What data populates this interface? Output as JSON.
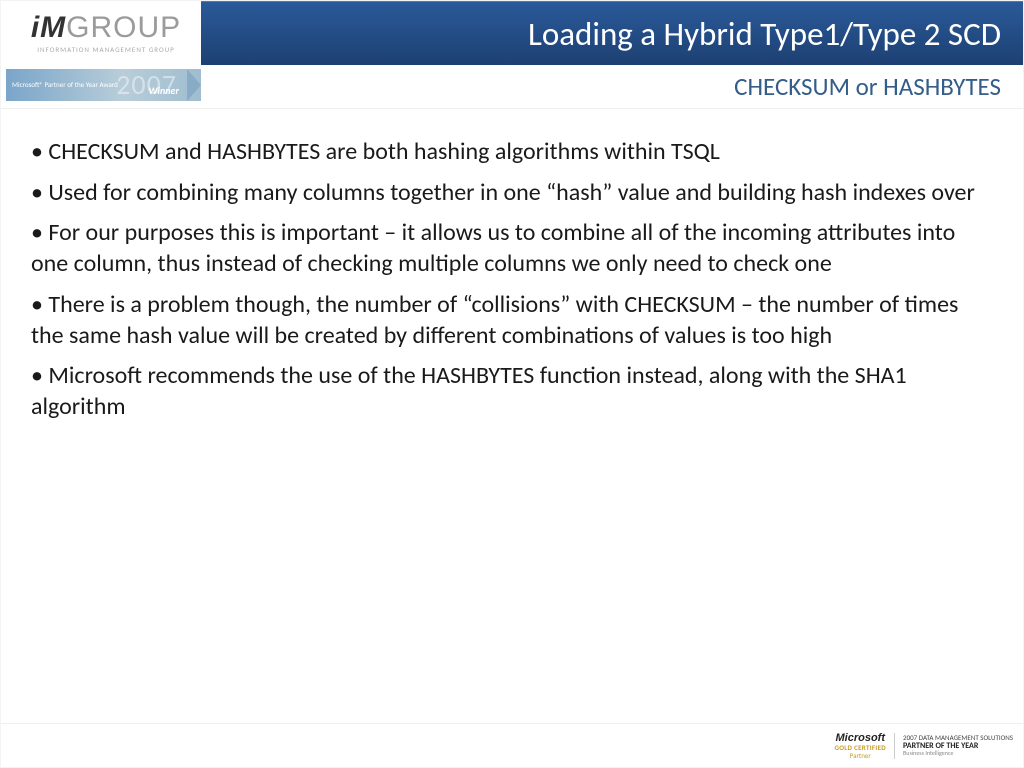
{
  "header": {
    "logo_main_bold": "iM",
    "logo_main_rest": "GROUP",
    "logo_sub": "INFORMATION MANAGEMENT GROUP",
    "title": "Loading a Hybrid Type1/Type 2 SCD"
  },
  "subheader": {
    "badge_lines": "Microsoft® Partner\nof the Year Award",
    "badge_year": "2007",
    "badge_winner": "Winner",
    "subtitle": "CHECKSUM or HASHBYTES"
  },
  "bullets": [
    "CHECKSUM and HASHBYTES are both hashing algorithms within TSQL",
    "Used for combining many columns together in one “hash” value and building hash indexes over",
    "For our purposes this is important – it allows us to combine all of the incoming attributes into one column, thus instead of checking multiple columns we only need to check one",
    "There is a problem though, the number of “collisions” with CHECKSUM – the number of times the same hash value will be created by different combinations of values is too high",
    "Microsoft recommends the use of the HASHBYTES function instead, along with the SHA1 algorithm"
  ],
  "footer": {
    "ms_name": "Microsoft",
    "ms_gold": "GOLD CERTIFIED",
    "ms_partner": "Partner",
    "poty_top": "2007 DATA MANAGEMENT SOLUTIONS",
    "poty_main": "PARTNER OF THE YEAR",
    "poty_sub": "Business Intelligence"
  }
}
